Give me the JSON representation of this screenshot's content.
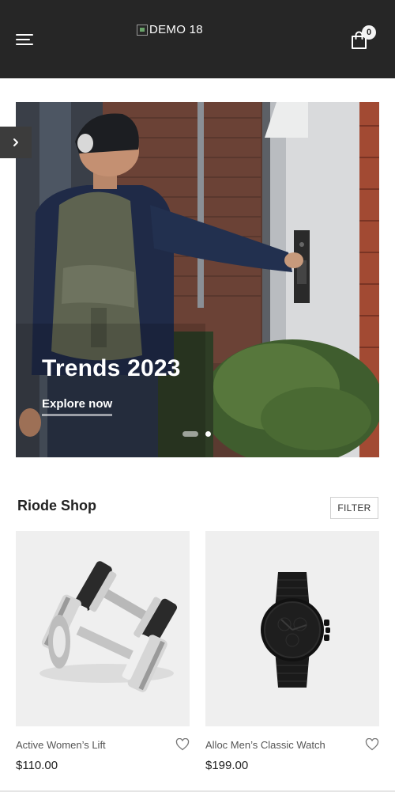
{
  "header": {
    "logo_alt": "DEMO 18",
    "cart_count": "0",
    "bg_color": "#262626"
  },
  "hero": {
    "title": "Trends 2023",
    "cta_label": "Explore now",
    "slides": 2,
    "active_slide": 1
  },
  "shop": {
    "title": "Riode Shop",
    "filter_label": "FILTER",
    "products": [
      {
        "name": "Active Women’s Lift",
        "price": "$110.00",
        "image": "dumbbells"
      },
      {
        "name": "Alloc Men’s Classic Watch",
        "price": "$199.00",
        "image": "black-watch"
      }
    ]
  },
  "icons": {
    "menu": "hamburger-menu-icon",
    "cart": "shopping-bag-icon",
    "slider_next": "chevron-right-icon",
    "wishlist": "heart-outline-icon"
  }
}
